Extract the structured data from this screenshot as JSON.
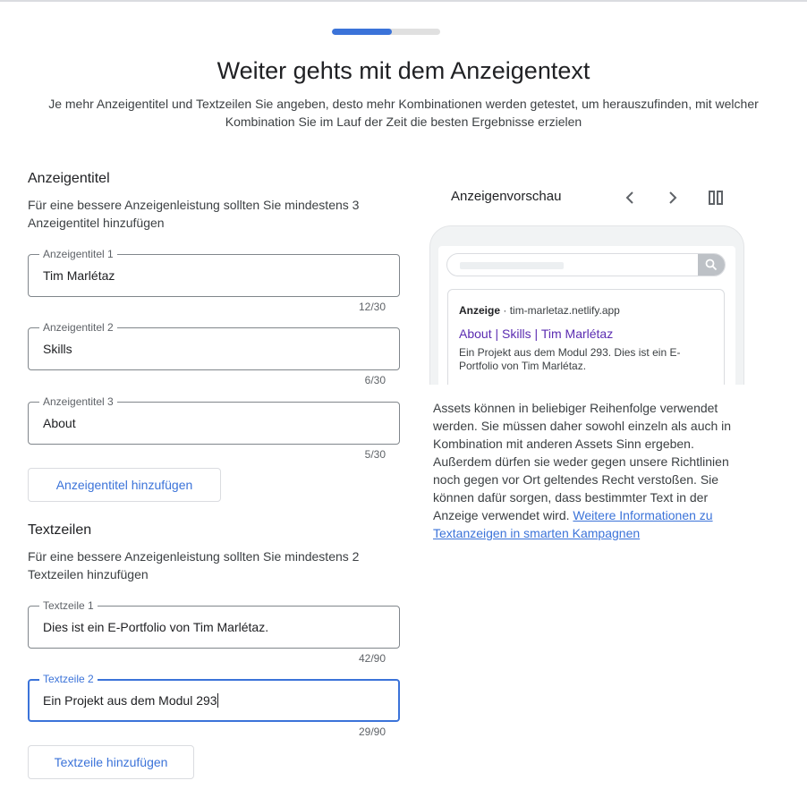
{
  "header": {
    "progress_fraction": 0.55,
    "title": "Weiter gehts mit dem Anzeigentext",
    "subtitle": "Je mehr Anzeigentitel und Textzeilen Sie angeben, desto mehr Kombinationen werden getestet, um herauszufinden, mit welcher Kombination Sie im Lauf der Zeit die besten Ergebnisse erzielen"
  },
  "headlines": {
    "title": "Anzeigentitel",
    "hint": "Für eine bessere Anzeigenleistung sollten Sie mindestens 3 Anzeigentitel hinzufügen",
    "fields": [
      {
        "label": "Anzeigentitel 1",
        "value": "Tim Marlétaz",
        "counter": "12/30"
      },
      {
        "label": "Anzeigentitel 2",
        "value": "Skills",
        "counter": "6/30"
      },
      {
        "label": "Anzeigentitel 3",
        "value": "About",
        "counter": "5/30"
      }
    ],
    "add_button": "Anzeigentitel hinzufügen"
  },
  "descriptions": {
    "title": "Textzeilen",
    "hint": "Für eine bessere Anzeigenleistung sollten Sie mindestens 2 Textzeilen hinzufügen",
    "fields": [
      {
        "label": "Textzeile 1",
        "value": "Dies ist ein E-Portfolio von Tim Marlétaz.",
        "counter": "42/90"
      },
      {
        "label": "Textzeile 2",
        "value": "Ein Projekt aus dem Modul 293",
        "counter": "29/90"
      }
    ],
    "add_button": "Textzeile hinzufügen"
  },
  "preview": {
    "title": "Anzeigenvorschau",
    "icons": {
      "prev": "chevron-left-icon",
      "next": "chevron-right-icon",
      "layout": "columns-icon",
      "search": "search-icon"
    },
    "ad_label": "Anzeige",
    "separator": " · ",
    "domain": "tim-marletaz.netlify.app",
    "headline": "About | Skills | Tim Marlétaz",
    "description": "Ein Projekt aus dem Modul 293. Dies ist ein E-Portfolio von Tim Marlétaz."
  },
  "info": {
    "text": "Assets können in beliebiger Reihenfolge verwendet werden. Sie müssen daher sowohl einzeln als auch in Kombination mit anderen Assets Sinn ergeben. Außerdem dürfen sie weder gegen unsere Richtlinien noch gegen vor Ort geltendes Recht verstoßen. Sie können dafür sorgen, dass bestimmter Text in der Anzeige verwendet wird. ",
    "link": "Weitere Informationen zu Textanzeigen in smarten Kampagnen"
  },
  "colors": {
    "accent": "#3b73d9",
    "ad_headline": "#5b2cb1",
    "border": "#80868b"
  }
}
